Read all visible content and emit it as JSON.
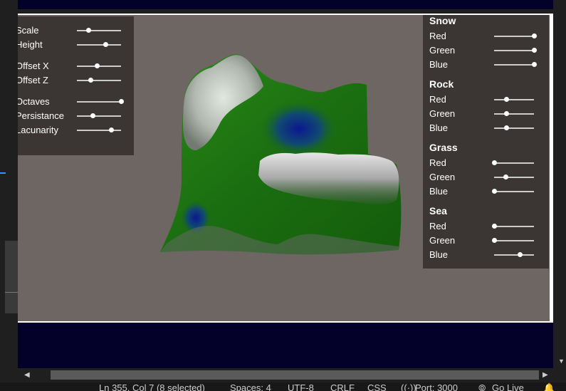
{
  "terrain_controls": [
    {
      "label": "Scale",
      "value": 0.25
    },
    {
      "label": "Height",
      "value": 0.65
    },
    {
      "label": "Offset X",
      "value": 0.45
    },
    {
      "label": "Offset Z",
      "value": 0.3
    },
    {
      "label": "Octaves",
      "value": 1.0
    },
    {
      "label": "Persistance",
      "value": 0.35
    },
    {
      "label": "Lacunarity",
      "value": 0.78
    }
  ],
  "color_sections": [
    {
      "title": "Snow",
      "channels": [
        {
          "label": "Red",
          "value": 1.0
        },
        {
          "label": "Green",
          "value": 1.0
        },
        {
          "label": "Blue",
          "value": 1.0
        }
      ]
    },
    {
      "title": "Rock",
      "channels": [
        {
          "label": "Red",
          "value": 0.3
        },
        {
          "label": "Green",
          "value": 0.3
        },
        {
          "label": "Blue",
          "value": 0.3
        }
      ]
    },
    {
      "title": "Grass",
      "channels": [
        {
          "label": "Red",
          "value": 0.0
        },
        {
          "label": "Green",
          "value": 0.28
        },
        {
          "label": "Blue",
          "value": 0.0
        }
      ]
    },
    {
      "title": "Sea",
      "channels": [
        {
          "label": "Red",
          "value": 0.0
        },
        {
          "label": "Green",
          "value": 0.0
        },
        {
          "label": "Blue",
          "value": 0.65
        }
      ]
    }
  ],
  "status": {
    "position": "Ln 355, Col 7 (8 selected)",
    "spaces": "Spaces: 4",
    "encoding": "UTF-8",
    "eol": "CRLF",
    "language": "CSS",
    "port": "Port: 3000",
    "golive": "Go Live"
  },
  "colors": {
    "viewport_bg": "#6e6663",
    "band": "#03002a",
    "grass": "#1b6e10",
    "sea": "#0a1aa0",
    "snow": "#e8e8e8"
  }
}
